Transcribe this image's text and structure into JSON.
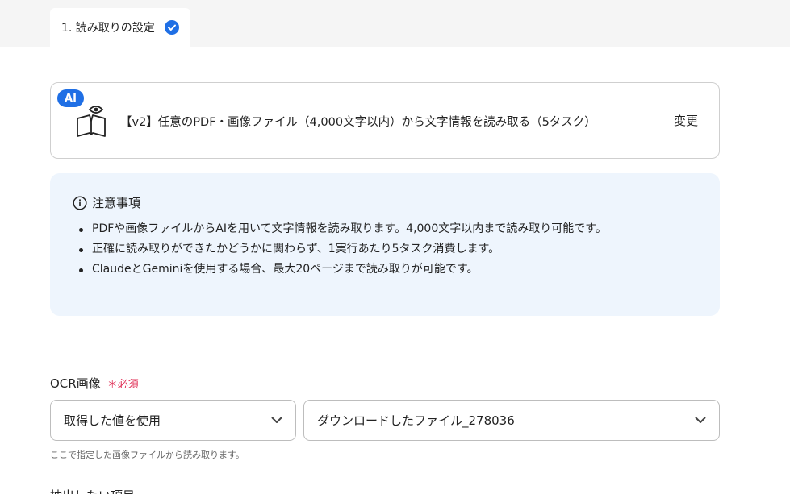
{
  "tab": {
    "label": "1. 読み取りの設定"
  },
  "action": {
    "badge": "AI",
    "title": "【v2】任意のPDF・画像ファイル（4,000文字以内）から文字情報を読み取る（5タスク）",
    "change_label": "変更"
  },
  "notice": {
    "title": "注意事項",
    "items": [
      "PDFや画像ファイルからAIを用いて文字情報を読み取ります。4,000文字以内まで読み取り可能です。",
      "正確に読み取りができたかどうかに関わらず、1実行あたり5タスク消費します。",
      "ClaudeとGeminiを使用する場合、最大20ページまで読み取りが可能です。"
    ]
  },
  "ocr_field": {
    "label": "OCR画像",
    "required": "＊必須",
    "source_select": "取得した値を使用",
    "file_select": "ダウンロードしたファイル_278036",
    "helper": "ここで指定した画像ファイルから読み取ります。"
  },
  "next_field": {
    "label": "抽出したい項目"
  },
  "colors": {
    "accent": "#1f6fe5",
    "required": "#e0345a",
    "notice_bg": "#eef5fd"
  },
  "icons": [
    "check-circle-icon",
    "book-eye-icon",
    "info-icon",
    "chevron-down-icon"
  ]
}
